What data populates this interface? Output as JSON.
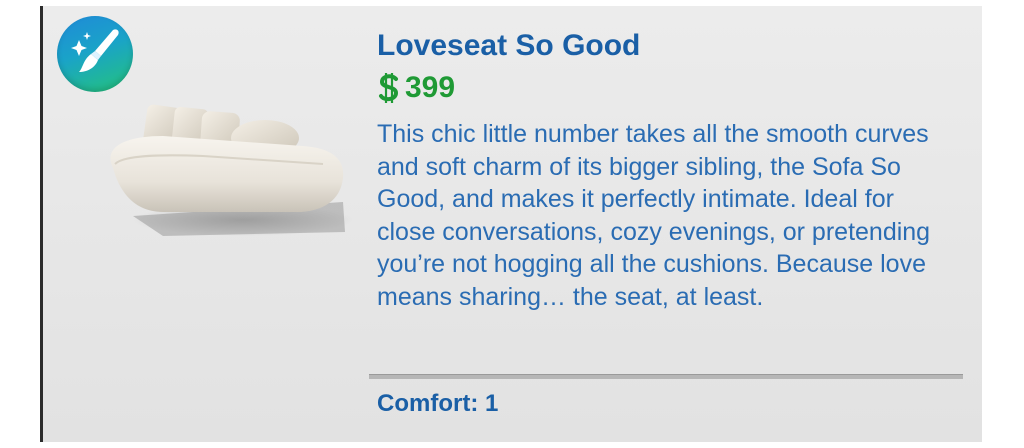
{
  "item": {
    "name": "Loveseat So Good",
    "price": "399",
    "currency_icon": "simoleon-icon",
    "description": "This chic little number takes all the smooth curves and soft charm of its bigger sibling, the Sofa So Good, and makes it perfectly intimate. Ideal for close conversations, cozy evenings, or pretending you’re not hogging all the cushions. Because love means sharing… the seat, at least.",
    "stat_label": "Comfort: 1",
    "pack_icon": "paintbrush-sparkle-icon",
    "thumbnail": "loveseat-thumbnail"
  },
  "colors": {
    "title": "#1a5fa6",
    "price": "#1f9a35",
    "description": "#2a6cb3",
    "panel": "#e6e6e6"
  }
}
